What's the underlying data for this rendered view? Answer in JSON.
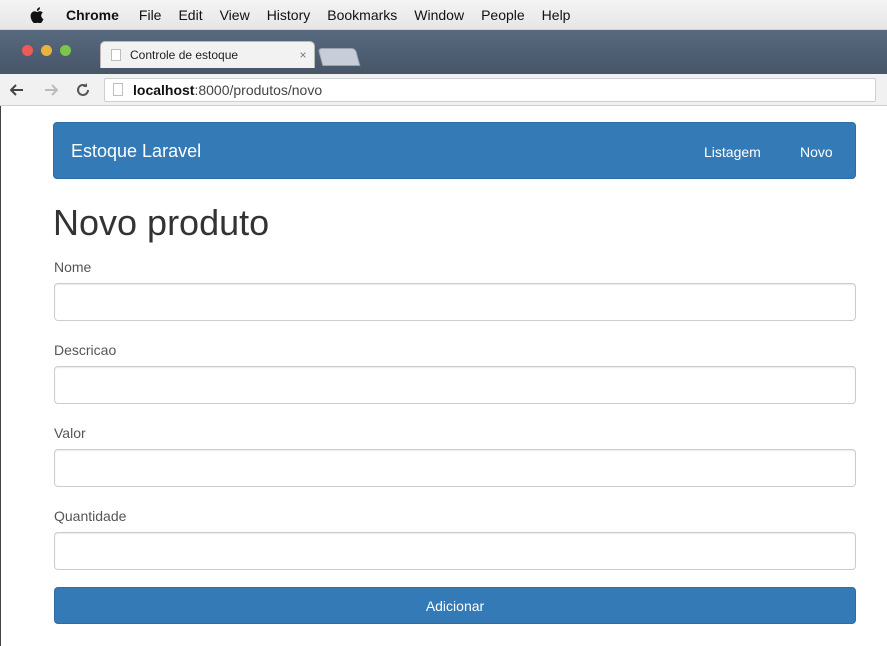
{
  "menubar": {
    "app": "Chrome",
    "items": [
      "File",
      "Edit",
      "View",
      "History",
      "Bookmarks",
      "Window",
      "People",
      "Help"
    ]
  },
  "browser": {
    "tab_title": "Controle de estoque",
    "tab_close": "×",
    "url_host": "localhost",
    "url_path": ":8000/produtos/novo"
  },
  "navbar": {
    "brand": "Estoque Laravel",
    "links": [
      "Listagem",
      "Novo"
    ]
  },
  "form": {
    "title": "Novo produto",
    "fields": [
      {
        "label": "Nome",
        "value": ""
      },
      {
        "label": "Descricao",
        "value": ""
      },
      {
        "label": "Valor",
        "value": ""
      },
      {
        "label": "Quantidade",
        "value": ""
      }
    ],
    "submit_label": "Adicionar"
  },
  "colors": {
    "primary": "#337ab7",
    "traffic_close": "#ec5b56",
    "traffic_min": "#e8b23c",
    "traffic_max": "#7cc648"
  }
}
